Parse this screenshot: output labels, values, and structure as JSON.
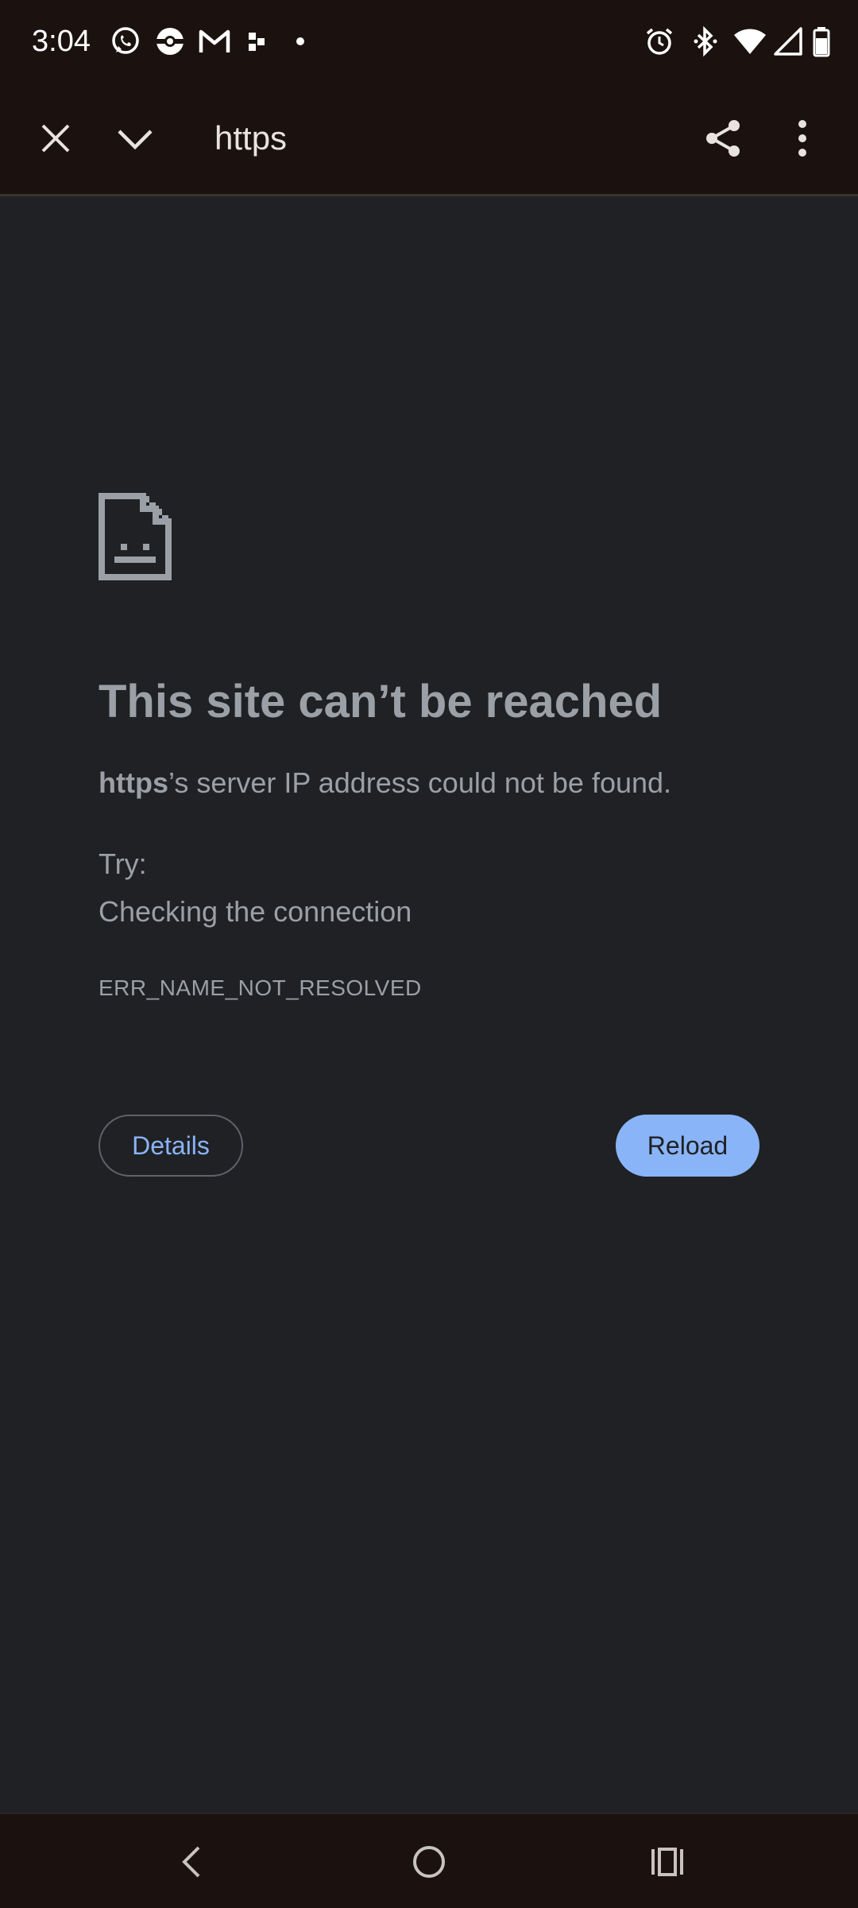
{
  "status_bar": {
    "time": "3:04",
    "left_icons": [
      "whatsapp-icon",
      "pokeball-icon",
      "gmail-icon",
      "app-icon",
      "dot-icon"
    ],
    "right_icons": [
      "alarm-icon",
      "bluetooth-icon",
      "wifi-icon",
      "cell-signal-icon",
      "battery-icon"
    ]
  },
  "toolbar": {
    "url": "https",
    "close_icon": "close-icon",
    "collapse_icon": "chevron-down-icon",
    "share_icon": "share-icon",
    "menu_icon": "more-vert-icon"
  },
  "error_page": {
    "heading": "This site can’t be reached",
    "host": "https",
    "summary_rest": "’s server IP address could not be found.",
    "try_label": "Try:",
    "suggestion": "Checking the connection",
    "error_code": "ERR_NAME_NOT_RESOLVED",
    "details_label": "Details",
    "reload_label": "Reload"
  },
  "nav_bar": {
    "icons": [
      "back-icon",
      "home-icon",
      "recents-icon"
    ]
  },
  "colors": {
    "system_bar_bg": "#1b1210",
    "page_bg": "#202124",
    "text_grey": "#9aa0a6",
    "accent_blue": "#8ab4f8"
  }
}
